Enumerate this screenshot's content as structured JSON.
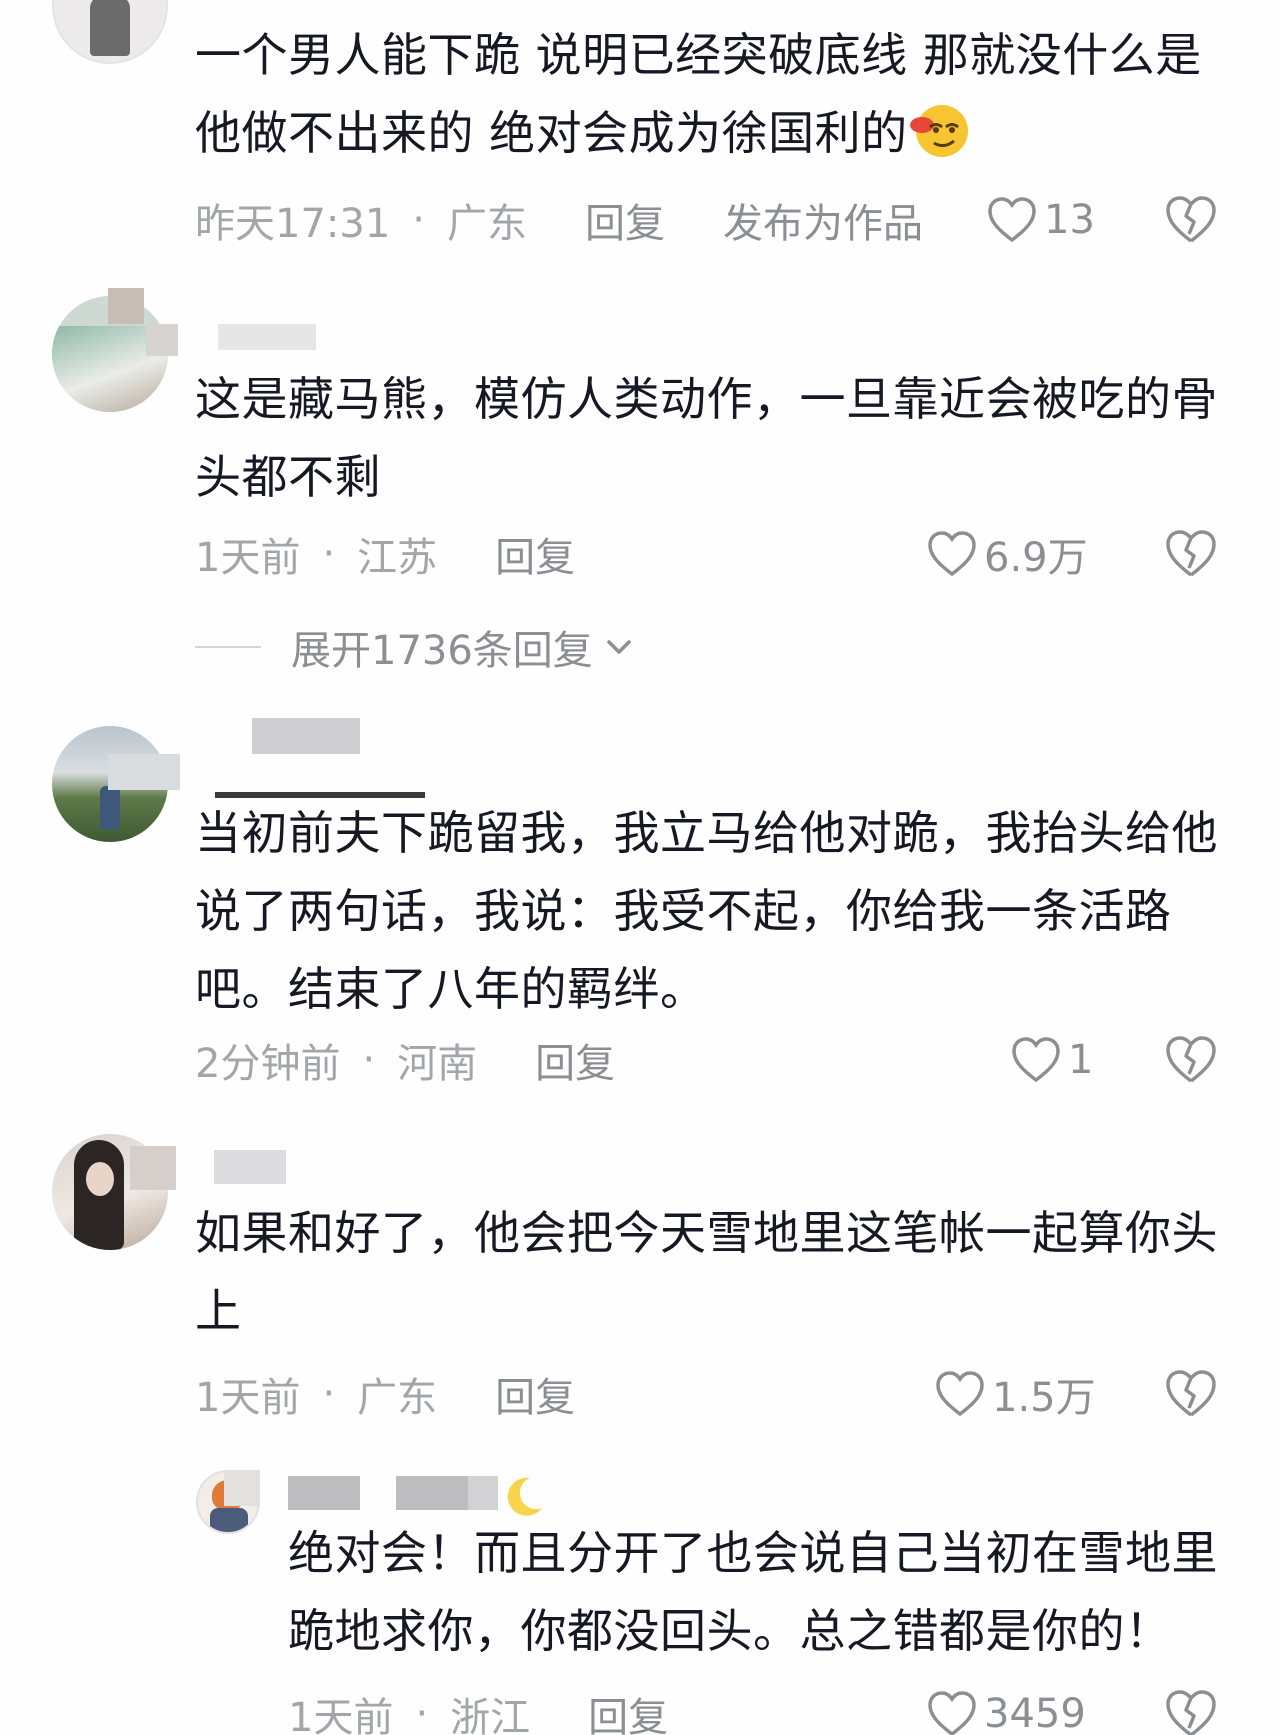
{
  "comments": [
    {
      "text": "一个男人能下跪  说明已经突破底线  那就没什么是他做不出来的  绝对会成为徐国利的",
      "emoji": "smirk-face-emoji",
      "time": "昨天17:31",
      "location": "广东",
      "reply_label": "回复",
      "publish_label": "发布为作品",
      "likes": "13"
    },
    {
      "text": "这是藏马熊，模仿人类动作，一旦靠近会被吃的骨头都不剩",
      "time": "1天前",
      "location": "江苏",
      "reply_label": "回复",
      "likes": "6.9万",
      "expand_label": "展开1736条回复"
    },
    {
      "text": "当初前夫下跪留我，我立马给他对跪，我抬头给他说了两句话，我说：我受不起，你给我一条活路吧。结束了八年的羁绊。",
      "time": "2分钟前",
      "location": "河南",
      "reply_label": "回复",
      "likes": "1"
    },
    {
      "text": "如果和好了，他会把今天雪地里这笔帐一起算你头上",
      "time": "1天前",
      "location": "广东",
      "reply_label": "回复",
      "likes": "1.5万"
    }
  ],
  "reply": {
    "username_emoji": "crescent-moon-emoji",
    "text": "绝对会！而且分开了也会说自己当初在雪地里跪地求你，你都没回头。总之错都是你的！",
    "time": "1天前",
    "location": "浙江",
    "reply_label": "回复",
    "likes": "3459"
  },
  "dot": "·",
  "colors": {
    "text": "#161823",
    "meta": "#a4a5aa",
    "icon": "#8d8e94"
  }
}
